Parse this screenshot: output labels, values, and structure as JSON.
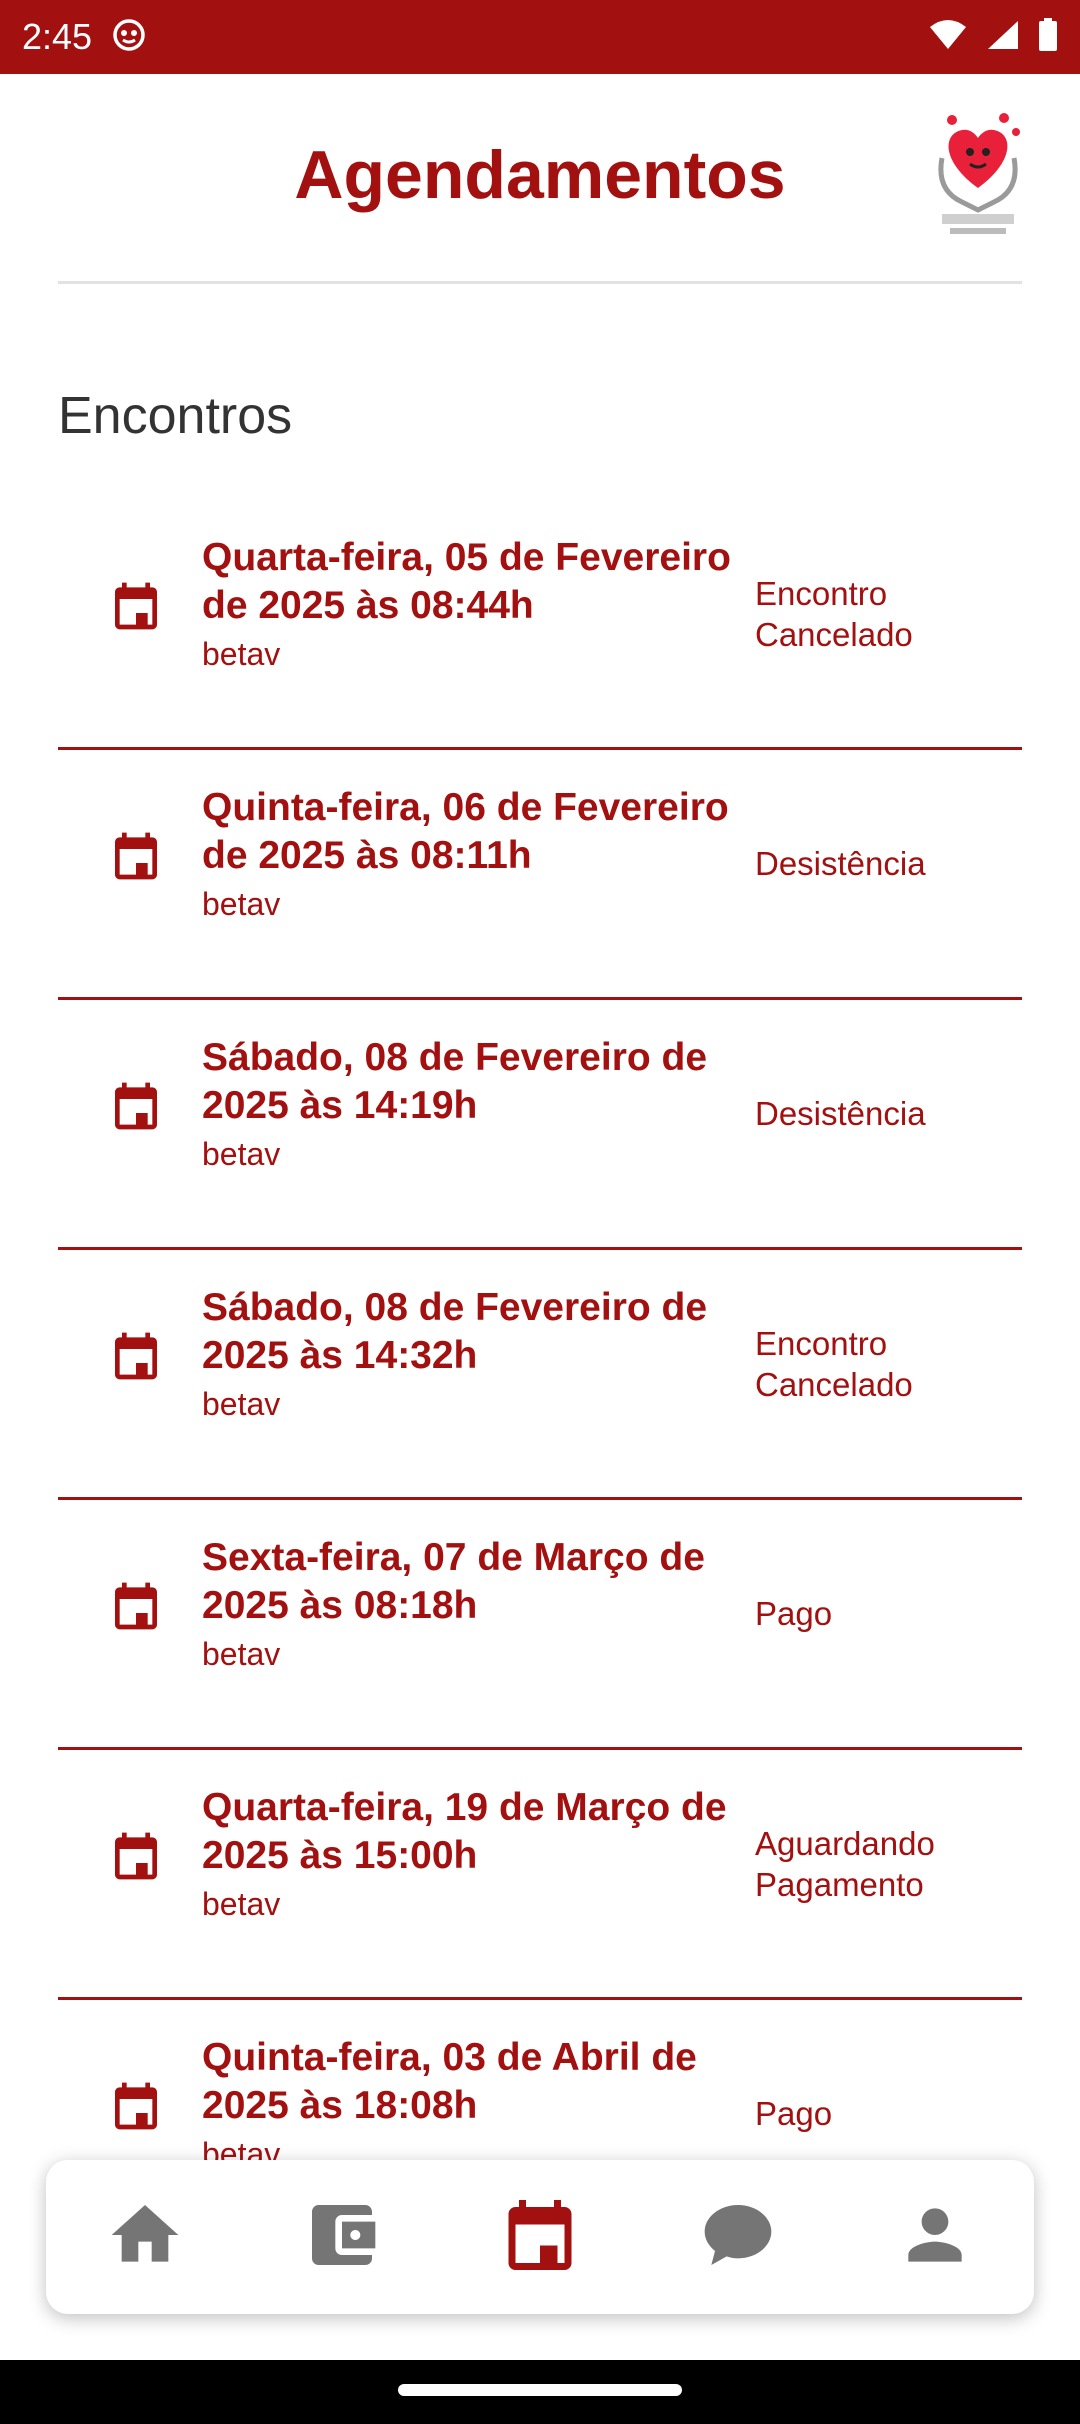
{
  "status_bar": {
    "time": "2:45"
  },
  "header": {
    "title": "Agendamentos",
    "logo_alt": "SUGAR FRIENDS"
  },
  "section": {
    "title": "Encontros"
  },
  "appointments": [
    {
      "when": "Quarta-feira, 05 de Fevereiro de 2025 às 08:44h",
      "who": "betav",
      "status": "Encontro Cancelado"
    },
    {
      "when": "Quinta-feira, 06 de Fevereiro de 2025 às 08:11h",
      "who": "betav",
      "status": "Desistência"
    },
    {
      "when": "Sábado, 08 de Fevereiro de 2025 às 14:19h",
      "who": "betav",
      "status": "Desistência"
    },
    {
      "when": "Sábado, 08 de Fevereiro de 2025 às 14:32h",
      "who": "betav",
      "status": "Encontro Cancelado"
    },
    {
      "when": "Sexta-feira, 07 de Março de 2025 às 08:18h",
      "who": "betav",
      "status": "Pago"
    },
    {
      "when": "Quarta-feira, 19 de Março de 2025 às 15:00h",
      "who": "betav",
      "status": "Aguardando Pagamento"
    },
    {
      "when": "Quinta-feira, 03 de Abril de 2025 às 18:08h",
      "who": "betav",
      "status": "Pago"
    }
  ],
  "bottom_nav": [
    {
      "icon": "home-icon",
      "active": false
    },
    {
      "icon": "wallet-icon",
      "active": false
    },
    {
      "icon": "calendar-icon",
      "active": true
    },
    {
      "icon": "chat-icon",
      "active": false
    },
    {
      "icon": "person-icon",
      "active": false
    }
  ],
  "colors": {
    "accent": "#a31010",
    "inactive_icon": "#757575",
    "divider": "#e2e2e2"
  }
}
